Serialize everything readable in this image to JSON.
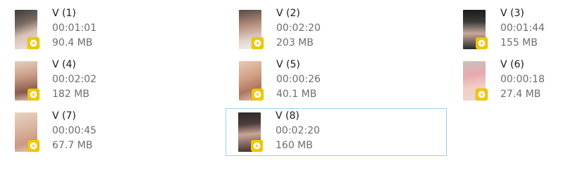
{
  "colors": {
    "selection_border": "#99d1ea",
    "play_badge": "#f2c500",
    "name_text": "#1a1a1a",
    "meta_text": "#6d6d6d"
  },
  "files": [
    {
      "name": "V (1)",
      "duration": "00:01:01",
      "size": "90.4 MB",
      "icon": "video-thumbnail-icon"
    },
    {
      "name": "V (2)",
      "duration": "00:02:20",
      "size": "203 MB",
      "icon": "video-thumbnail-icon"
    },
    {
      "name": "V (3)",
      "duration": "00:01:44",
      "size": "155 MB",
      "icon": "video-thumbnail-icon"
    },
    {
      "name": "V (4)",
      "duration": "00:02:02",
      "size": "182 MB",
      "icon": "video-thumbnail-icon"
    },
    {
      "name": "V (5)",
      "duration": "00:00:26",
      "size": "40.1 MB",
      "icon": "video-thumbnail-icon"
    },
    {
      "name": "V (6)",
      "duration": "00:00:18",
      "size": "27.4 MB",
      "icon": "video-thumbnail-icon"
    },
    {
      "name": "V (7)",
      "duration": "00:00:45",
      "size": "67.7 MB",
      "icon": "video-thumbnail-icon"
    },
    {
      "name": "V (8)",
      "duration": "00:02:20",
      "size": "160 MB",
      "icon": "video-thumbnail-icon",
      "selected": true
    }
  ]
}
